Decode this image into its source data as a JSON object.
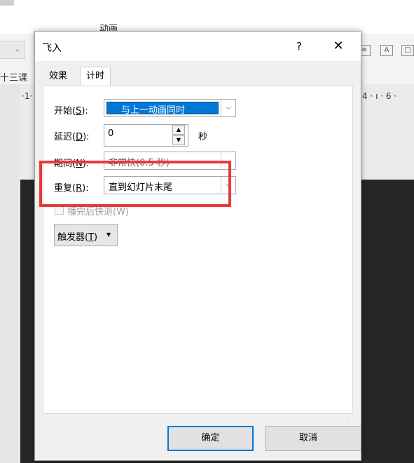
{
  "background": {
    "ribbon_tab_label": "动画",
    "outline_label": "十三课",
    "ruler_left": "·1·",
    "ruler_right": "4 · ı · 6 ·"
  },
  "dialog": {
    "title": "飞入",
    "help_label": "?",
    "close_label": "✕",
    "tabs": [
      {
        "label": "效果",
        "active": false
      },
      {
        "label": "计时",
        "active": true
      }
    ],
    "start": {
      "label": "开始(",
      "accel": "S",
      "label_end": "):",
      "value": "与上一动画同时"
    },
    "delay": {
      "label": "延迟(",
      "accel": "D",
      "label_end": "):",
      "value": "0",
      "unit": "秒"
    },
    "duration": {
      "label": "期间(",
      "accel": "N",
      "label_end": "):",
      "value": "非常快(0.5 秒)"
    },
    "repeat": {
      "label": "重复(",
      "accel": "R",
      "label_end": "):",
      "value": "直到幻灯片末尾"
    },
    "rewind": {
      "label": "播完后快退(W)",
      "checked": false,
      "enabled": false
    },
    "trigger": {
      "label": "触发器(",
      "accel": "T",
      "label_end": ")",
      "caret": "▾"
    },
    "buttons": {
      "ok": "确定",
      "cancel": "取消"
    }
  },
  "colors": {
    "highlight": "#e8393a",
    "selection": "#0078d7"
  }
}
